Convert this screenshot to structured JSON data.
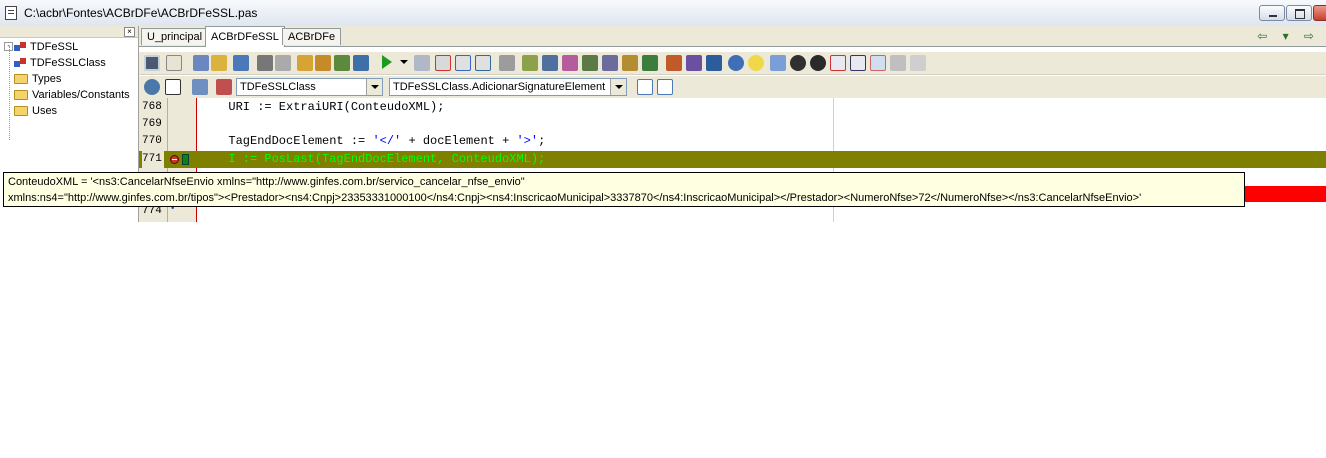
{
  "window": {
    "title": "C:\\acbr\\Fontes\\ACBrDFe\\ACBrDFeSSL.pas"
  },
  "tree": {
    "close_glyph": "×",
    "expander_glyph": "-",
    "items": [
      {
        "label": "TDFeSSL",
        "icon": "class-icon"
      },
      {
        "label": "TDFeSSLClass",
        "icon": "class-icon"
      },
      {
        "label": "Types",
        "icon": "folder-icon"
      },
      {
        "label": "Variables/Constants",
        "icon": "folder-icon"
      },
      {
        "label": "Uses",
        "icon": "folder-icon"
      }
    ]
  },
  "tabs": [
    {
      "label": "U_principal",
      "active": false
    },
    {
      "label": "ACBrDFeSSL",
      "active": true
    },
    {
      "label": "ACBrDFe",
      "active": false
    }
  ],
  "navigation": {
    "arrows": "⇦ ▾ ⇨"
  },
  "toolbar2": {
    "class_combo": "TDFeSSLClass",
    "method_combo": "TDFeSSLClass.AdicionarSignatureElement"
  },
  "editor": {
    "lines": [
      {
        "num": "768",
        "code": "  URI := ExtraiURI(ConteudoXML);",
        "state": "normal"
      },
      {
        "num": "769",
        "code": "",
        "state": "normal"
      },
      {
        "num": "770",
        "code_pre": "  TagEndDocElement := ",
        "code_str1": "'</'",
        "code_mid": " + docElement + ",
        "code_str2": "'>'",
        "code_post": ";",
        "state": "normal"
      },
      {
        "num": "771",
        "code": "  I := PosLast(TagEndDocElement, ConteudoXML);",
        "state": "exec"
      },
      {
        "num": "774",
        "code": "",
        "state": "normal"
      }
    ]
  },
  "hint": {
    "line1": "ConteudoXML = '<ns3:CancelarNfseEnvio xmlns=\"http://www.ginfes.com.br/servico_cancelar_nfse_envio\"",
    "line2": "xmlns:ns4=\"http://www.ginfes.com.br/tipos\"><Prestador><ns4:Cnpj>23353331000100</ns4:Cnpj><ns4:InscricaoMunicipal>3337870</ns4:InscricaoMunicipal></Prestador><NumeroNfse>72</NumeroNfse></ns3:CancelarNfseEnvio>'"
  },
  "colors": {
    "exec_line_bg": "#808000",
    "exec_line_fg": "#00ff00",
    "hint_bg": "#ffffe1",
    "breakpoint_bar": "#ff0000"
  }
}
